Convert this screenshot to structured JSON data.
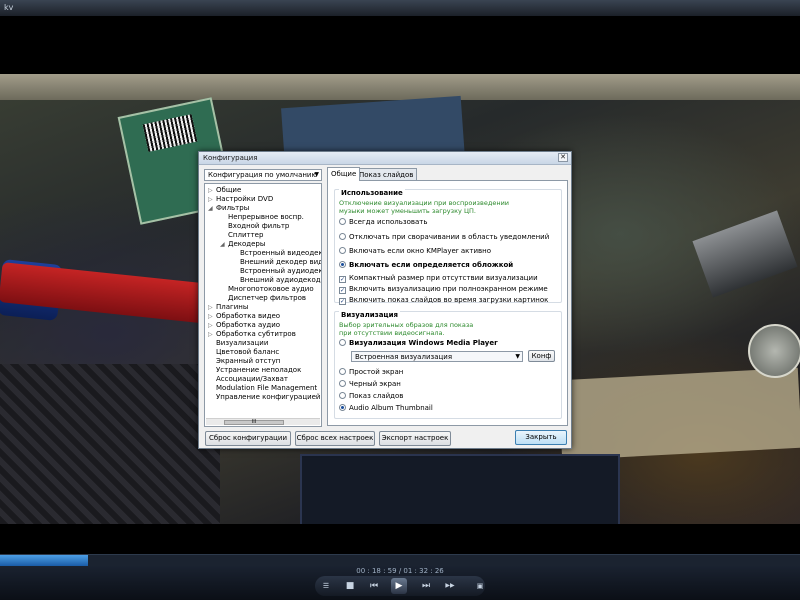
{
  "player": {
    "title": "kv",
    "timecode": "00 : 18 : 59 / 01 : 32 : 26",
    "progress": 0.11,
    "controls": {
      "stop": "■",
      "prev": "⏮",
      "play": "▶",
      "next": "⏭",
      "forward": "▶▶"
    }
  },
  "dialog": {
    "title": "Конфигурация",
    "close": "✕",
    "preset": "Конфигурация по умолчанию",
    "tree": [
      {
        "label": "Общие",
        "expander": "▷"
      },
      {
        "label": "Настройки DVD",
        "expander": "▷"
      },
      {
        "label": "Фильтры",
        "expander": "◢"
      },
      {
        "label": "Непрерывное воспр.",
        "expander": ""
      },
      {
        "label": "Входной фильтр",
        "expander": ""
      },
      {
        "label": "Сплиттер",
        "expander": ""
      },
      {
        "label": "Декодеры",
        "expander": "◢"
      },
      {
        "label": "Встроенный видеодекодер",
        "expander": ""
      },
      {
        "label": "Внешний декодер видео",
        "expander": ""
      },
      {
        "label": "Встроенный аудиодекодер",
        "expander": ""
      },
      {
        "label": "Внешний аудиодекодер",
        "expander": ""
      },
      {
        "label": "Многопотоковое аудио",
        "expander": ""
      },
      {
        "label": "Диспетчер фильтров",
        "expander": ""
      },
      {
        "label": "Плагины",
        "expander": "▷"
      },
      {
        "label": "Обработка видео",
        "expander": "▷"
      },
      {
        "label": "Обработка аудио",
        "expander": "▷"
      },
      {
        "label": "Обработка субтитров",
        "expander": "▷"
      },
      {
        "label": "Визуализации",
        "expander": ""
      },
      {
        "label": "Цветовой баланс",
        "expander": ""
      },
      {
        "label": "Экранный отступ",
        "expander": ""
      },
      {
        "label": "Устранение неполадок",
        "expander": ""
      },
      {
        "label": "Ассоциации/Захват",
        "expander": ""
      },
      {
        "label": "Modulation File Management",
        "expander": ""
      },
      {
        "label": "Управление конфигурацией",
        "expander": ""
      }
    ],
    "scroll_grip": "III",
    "tabs": [
      "Общие",
      "Показ слайдов"
    ],
    "usage": {
      "title": "Использование",
      "hint_line1": "Отключение визуализации при воспроизведении",
      "hint_line2": "музыки может уменьшить загрузку ЦП.",
      "radios": [
        {
          "label": "Всегда использовать",
          "checked": false
        },
        {
          "label": "Отключать при сворачивании в область уведомлений",
          "checked": false
        },
        {
          "label": "Включать если окно KMPlayer активно",
          "checked": false
        },
        {
          "label": "Включать если определяется обложкой",
          "checked": true
        }
      ],
      "checks": [
        {
          "label": "Компактный размер при отсутствии визуализации",
          "checked": true
        },
        {
          "label": "Включить визуализацию при полноэкранном режиме",
          "checked": true
        },
        {
          "label": "Включить показ слайдов во время загрузки картинок",
          "checked": true
        }
      ]
    },
    "visual": {
      "title": "Визуализация",
      "hint_line1": "Выбор зрительных образов для показа",
      "hint_line2": "при отсутствии видеосигнала.",
      "wmp_label": "Визуализация Windows Media Player",
      "select_value": "Встроенная визуализация",
      "conf_button": "Конф",
      "radios": [
        {
          "label": "Простой экран",
          "checked": false
        },
        {
          "label": "Черный экран",
          "checked": false
        },
        {
          "label": "Показ слайдов",
          "checked": false
        },
        {
          "label": "Audio Album Thumbnail",
          "checked": true
        }
      ]
    },
    "buttons": {
      "reset_config": "Сброс конфигурации",
      "reset_all": "Сброс всех настроек",
      "export": "Экспорт настроек",
      "close": "Закрыть"
    }
  }
}
